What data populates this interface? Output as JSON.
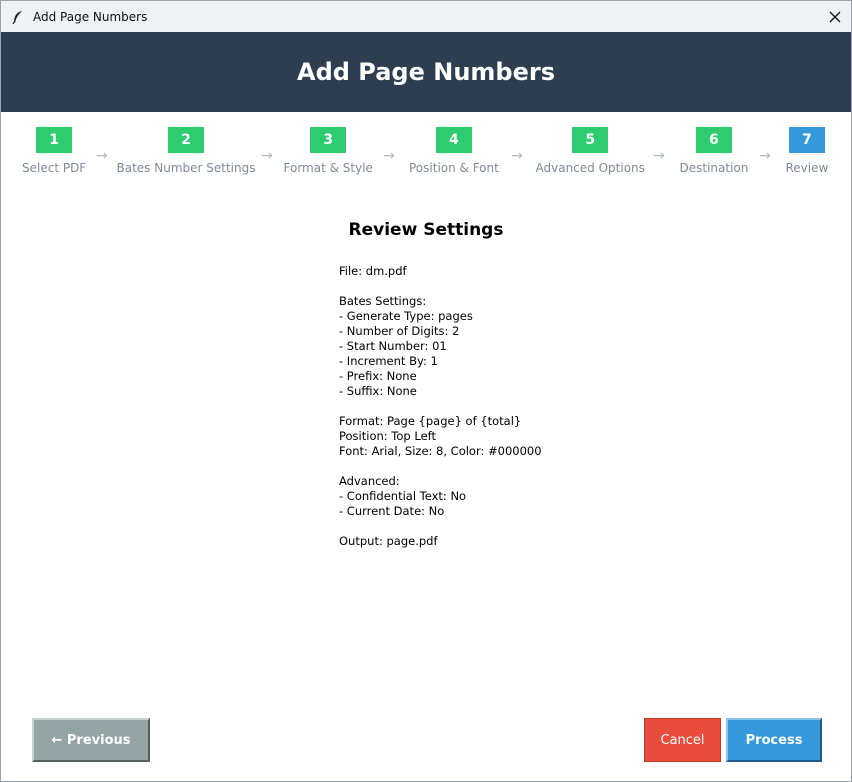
{
  "window": {
    "title": "Add Page Numbers"
  },
  "header": {
    "title": "Add Page Numbers"
  },
  "steps": [
    {
      "number": "1",
      "label": "Select PDF",
      "state": "done"
    },
    {
      "number": "2",
      "label": "Bates Number Settings",
      "state": "done"
    },
    {
      "number": "3",
      "label": "Format & Style",
      "state": "done"
    },
    {
      "number": "4",
      "label": "Position & Font",
      "state": "done"
    },
    {
      "number": "5",
      "label": "Advanced Options",
      "state": "done"
    },
    {
      "number": "6",
      "label": "Destination",
      "state": "done"
    },
    {
      "number": "7",
      "label": "Review",
      "state": "current"
    }
  ],
  "step_arrow": "→",
  "review": {
    "title": "Review Settings",
    "summary_lines": [
      "File: dm.pdf",
      "",
      "Bates Settings:",
      "- Generate Type: pages",
      "- Number of Digits: 2",
      "- Start Number: 01",
      "- Increment By: 1",
      "- Prefix: None",
      "- Suffix: None",
      "",
      "Format: Page {page} of {total}",
      "Position: Top Left",
      "Font: Arial, Size: 8, Color: #000000",
      "",
      "Advanced:",
      "- Confidential Text: No",
      "- Current Date: No",
      "",
      "Output: page.pdf"
    ]
  },
  "buttons": {
    "previous": "← Previous",
    "cancel": "Cancel",
    "process": "Process"
  },
  "colors": {
    "header_bg": "#2c3e50",
    "step_done": "#2ecc71",
    "step_current": "#3498db",
    "previous_bg": "#95a5a6",
    "cancel_bg": "#e74c3c",
    "process_bg": "#3498db"
  },
  "icons": {
    "app": "feather-icon",
    "close": "close-icon"
  }
}
